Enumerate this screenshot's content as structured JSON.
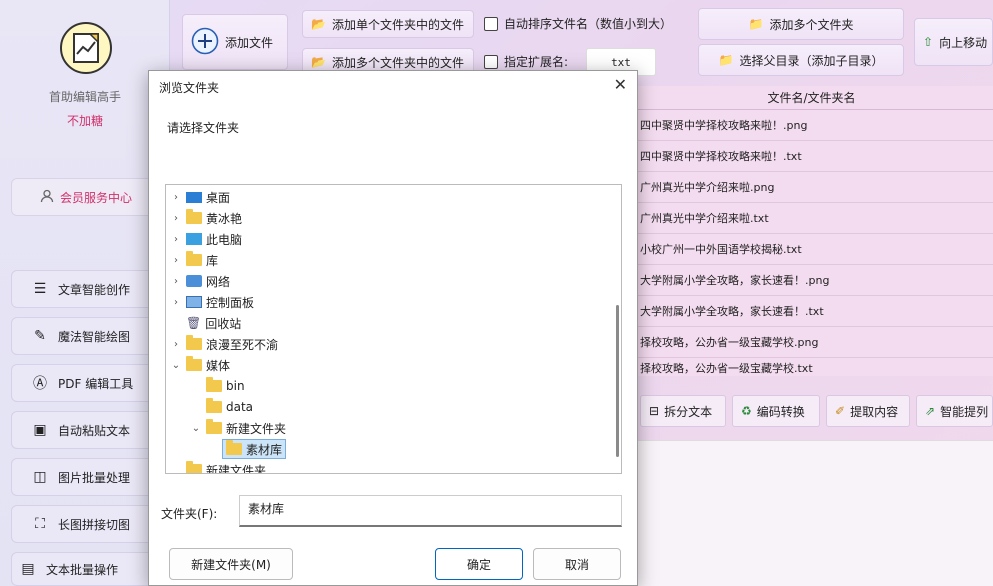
{
  "app": {
    "name": "首助编辑高手",
    "subtitle": "不加糖",
    "member": "会员服务中心"
  },
  "sidebar": {
    "items": [
      {
        "label": "文章智能创作",
        "icon": "list-icon"
      },
      {
        "label": "魔法智能绘图",
        "icon": "brush-icon"
      },
      {
        "label": "PDF 编辑工具",
        "icon": "pdf-icon"
      },
      {
        "label": "自动粘贴文本",
        "icon": "paste-icon"
      },
      {
        "label": "图片批量处理",
        "icon": "image-icon"
      },
      {
        "label": "长图拼接切图",
        "icon": "crop-icon"
      },
      {
        "label": "文本批量操作",
        "icon": "text-ops-icon"
      }
    ]
  },
  "toolbar": {
    "add_file": "添加文件",
    "add_from_single_folder": "添加单个文件夹中的文件",
    "add_from_multi_folders": "添加多个文件夹中的文件",
    "auto_sort": "自动排序文件名（数值小到大）",
    "ext_label": "指定扩展名:",
    "ext_value": "txt",
    "add_multi_folders": "添加多个文件夹",
    "choose_parent": "选择父目录（添加子目录）",
    "move_up": "向上移动"
  },
  "filelist": {
    "header": "文件名/文件夹名",
    "rows": [
      "四中聚贤中学择校攻略来啦！.png",
      "四中聚贤中学择校攻略来啦！.txt",
      "广州真光中学介绍来啦.png",
      "广州真光中学介绍来啦.txt",
      "小校广州一中外国语学校揭秘.txt",
      "大学附属小学全攻略，家长速看！.png",
      "大学附属小学全攻略，家长速看！.txt",
      "择校攻略，公办省一级宝藏学校.png",
      "择校攻略，公办省一级宝藏学校.txt"
    ]
  },
  "tools": {
    "split": "拆分文本",
    "encode": "编码转换",
    "extract": "提取内容",
    "smart": "智能提列"
  },
  "dialog": {
    "title": "浏览文件夹",
    "close": "✕",
    "prompt": "请选择文件夹",
    "tree": {
      "desktop": "桌面",
      "user": "黄冰艳",
      "this_pc": "此电脑",
      "library": "库",
      "network": "网络",
      "control_panel": "控制面板",
      "recycle": "回收站",
      "romance": "浪漫至死不渝",
      "media": "媒体",
      "bin": "bin",
      "data": "data",
      "new_folder_sub": "新建文件夹",
      "material": "素材库",
      "new_folder_root": "新建文件夹"
    },
    "folder_label": "文件夹(F):",
    "folder_value": "素材库",
    "new_folder_btn": "新建文件夹(M)",
    "ok": "确定",
    "cancel": "取消"
  },
  "colors": {
    "accent": "#d0306a",
    "dialog_primary": "#0067c0",
    "selection": "#cce4f7"
  }
}
